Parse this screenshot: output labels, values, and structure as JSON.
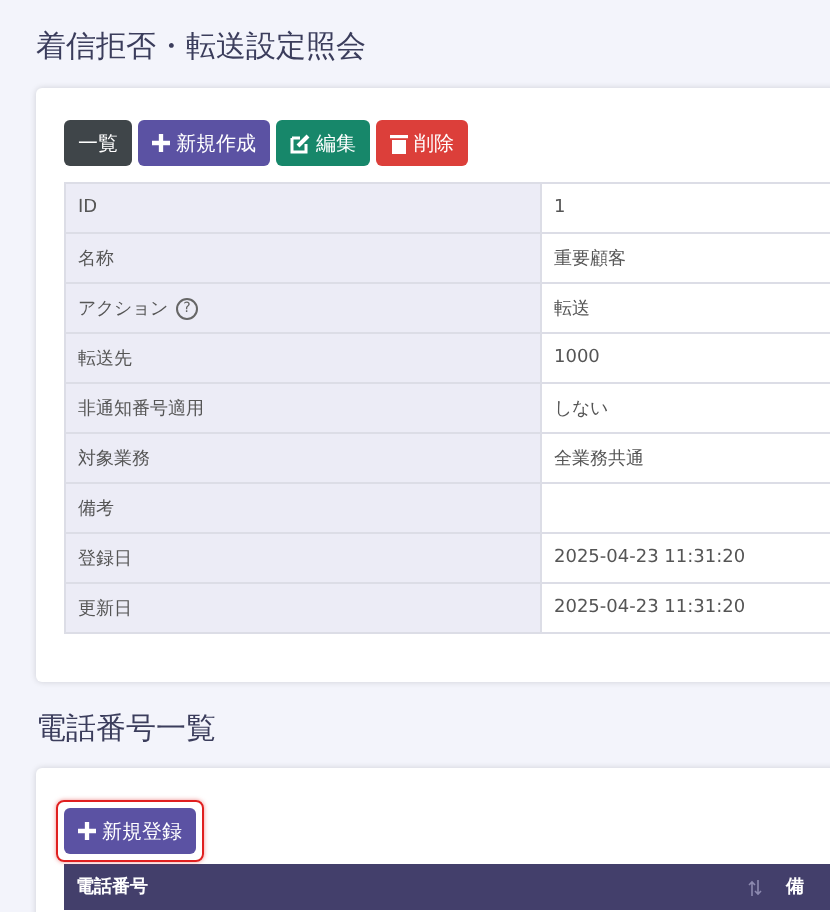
{
  "title": "着信拒否・転送設定照会",
  "toolbar": [
    {
      "kind": "list",
      "label": "一覧"
    },
    {
      "kind": "new",
      "label": "新規作成"
    },
    {
      "kind": "edit",
      "label": "編集"
    },
    {
      "kind": "delete",
      "label": "削除"
    }
  ],
  "details": [
    {
      "label": "ID",
      "value": "1"
    },
    {
      "label": "名称",
      "value": "重要顧客"
    },
    {
      "label": "アクション",
      "help": "?",
      "value": "転送"
    },
    {
      "label": "転送先",
      "value": "1000"
    },
    {
      "label": "非通知番号適用",
      "value": "しない"
    },
    {
      "label": "対象業務",
      "value": "全業務共通"
    },
    {
      "label": "備考"
    },
    {
      "label": "登録日",
      "value": "2025-04-23 11:31:20"
    },
    {
      "label": "更新日",
      "value": "2025-04-23 11:31:20"
    }
  ],
  "phone_section": {
    "title": "電話番号一覧",
    "add_button": {
      "label": "新規登録",
      "highlighted": true
    },
    "columns": [
      {
        "label": "電話番号",
        "sortable": true
      },
      {
        "label": "備",
        "sortable": false
      }
    ]
  }
}
